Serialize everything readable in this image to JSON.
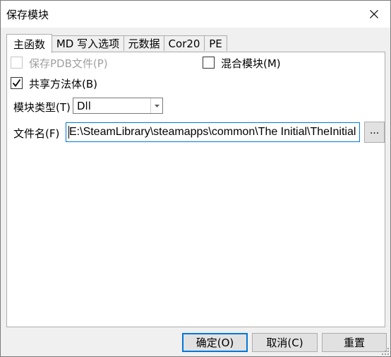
{
  "window": {
    "title": "保存模块"
  },
  "tabs": [
    {
      "label": "主函数"
    },
    {
      "label": "MD 写入选项"
    },
    {
      "label": "元数据"
    },
    {
      "label": "Cor20"
    },
    {
      "label": "PE"
    }
  ],
  "options": {
    "save_pdb": {
      "label": "保存PDB文件(P)",
      "checked": false,
      "enabled": false
    },
    "mixed_mode": {
      "label": "混合模块(M)",
      "checked": false
    },
    "share_method_bodies": {
      "label": "共享方法体(B)",
      "checked": true
    }
  },
  "module_type": {
    "label": "模块类型(T)",
    "value": "Dll"
  },
  "filename": {
    "label": "文件名(F)",
    "value": "E:\\SteamLibrary\\steamapps\\common\\The Initial\\TheInitial",
    "browse_label": "..."
  },
  "buttons": {
    "ok": "确定(O)",
    "cancel": "取消(C)",
    "reset": "重置"
  },
  "icons": {
    "close": "close-icon",
    "dropdown": "chevron-down-icon",
    "check": "check-icon",
    "resize": "resize-grip-icon"
  },
  "colors": {
    "accent": "#0078d7",
    "disabled_text": "#a0a0a0"
  }
}
